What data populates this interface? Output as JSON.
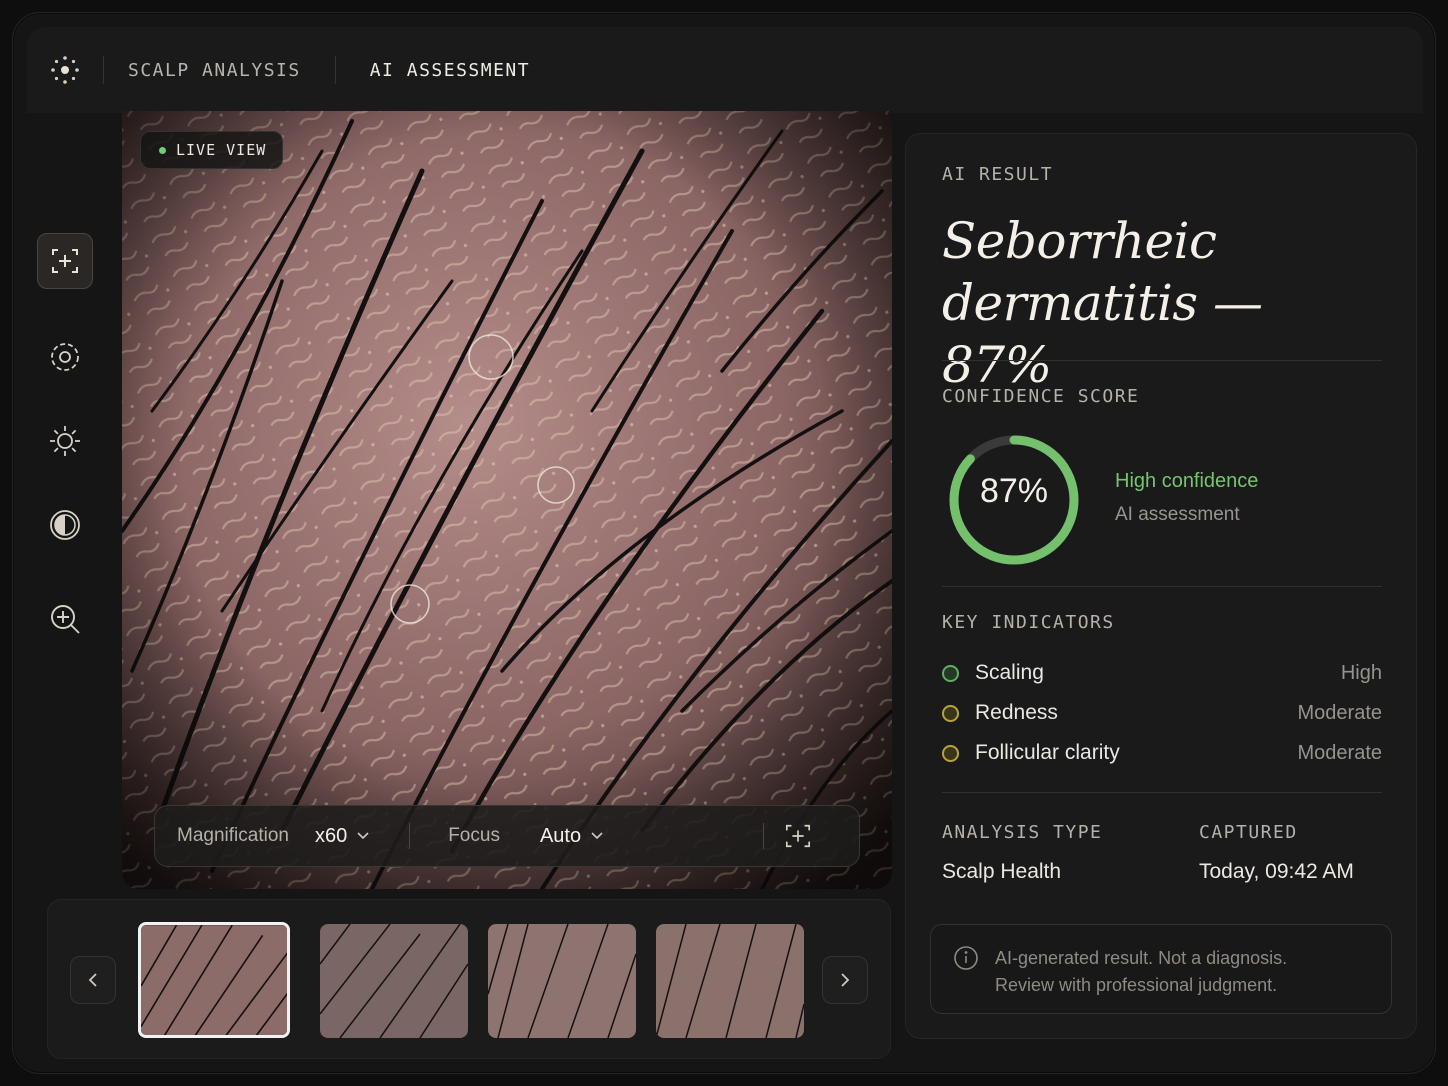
{
  "header": {
    "breadcrumb_1": "SCALP ANALYSIS",
    "breadcrumb_2": "AI ASSESSMENT"
  },
  "tools": [
    {
      "icon": "focus-capture-icon",
      "active": true
    },
    {
      "icon": "target-scan-icon",
      "active": false
    },
    {
      "icon": "brightness-icon",
      "active": false
    },
    {
      "icon": "contrast-icon",
      "active": false
    },
    {
      "icon": "zoom-in-icon",
      "active": false
    }
  ],
  "viewer": {
    "live_label": "LIVE VIEW",
    "magnification_label": "Magnification",
    "magnification_value": "x60",
    "focus_label": "Focus",
    "focus_value": "Auto"
  },
  "thumbnails": {
    "count": 4,
    "selected_index": 0
  },
  "result": {
    "section_label": "AI RESULT",
    "diagnosis": "Seborrheic dermatitis — 87%",
    "confidence_label": "CONFIDENCE SCORE",
    "confidence_value": "87%",
    "confidence_fraction": 0.87,
    "confidence_level": "High confidence",
    "confidence_source": "AI assessment",
    "indicators_label": "KEY INDICATORS",
    "indicators": [
      {
        "name": "Scaling",
        "value": "High",
        "color": "#5fae62"
      },
      {
        "name": "Redness",
        "value": "Moderate",
        "color": "#b8a43a"
      },
      {
        "name": "Follicular clarity",
        "value": "Moderate",
        "color": "#b8a43a"
      }
    ],
    "analysis_type_label": "ANALYSIS TYPE",
    "analysis_type_value": "Scalp Health",
    "captured_label": "CAPTURED",
    "captured_value": "Today, 09:42 AM",
    "disclaimer_line1": "AI-generated result. Not a diagnosis.",
    "disclaimer_line2": "Review with professional judgment."
  },
  "colors": {
    "accent_green": "#6fcf73",
    "moderate_yellow": "#b8a43a",
    "background": "#151515"
  }
}
